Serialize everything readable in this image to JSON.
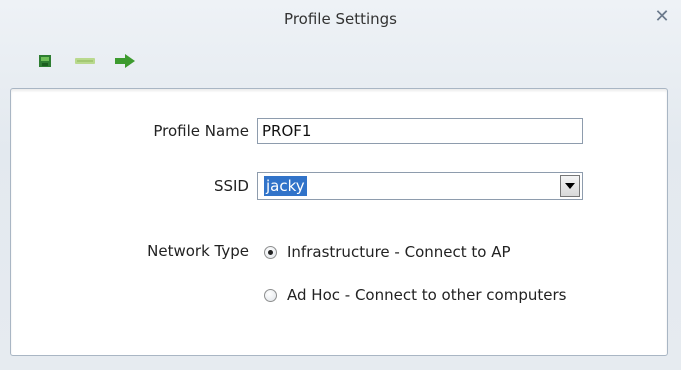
{
  "window": {
    "title": "Profile Settings",
    "close_icon": "close-icon"
  },
  "toolbar": {
    "icons": [
      "save-icon",
      "edit-icon",
      "arrow-right-icon"
    ],
    "colors": {
      "save": "#2e7d32",
      "edit": "#b9d98e",
      "next": "#3d9b2f"
    }
  },
  "form": {
    "profile_name_label": "Profile Name",
    "profile_name_value": "PROF1",
    "ssid_label": "SSID",
    "ssid_value": "jacky",
    "network_type_label": "Network Type",
    "network_type_options": [
      {
        "label": "Infrastructure - Connect to AP",
        "selected": true
      },
      {
        "label": "Ad Hoc - Connect to other computers",
        "selected": false
      }
    ]
  }
}
